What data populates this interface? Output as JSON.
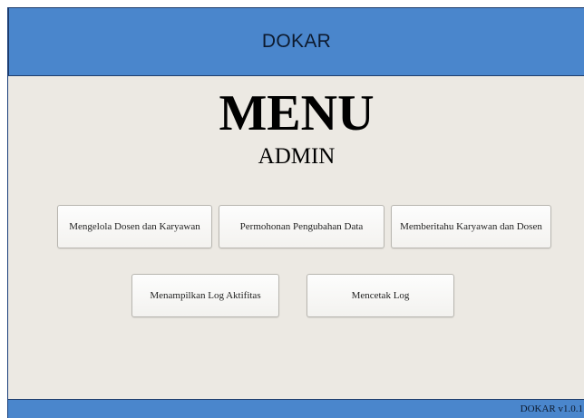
{
  "header": {
    "title": "DOKAR"
  },
  "menu": {
    "title": "MENU",
    "subtitle": "ADMIN"
  },
  "buttons": [
    {
      "label": "Mengelola Dosen dan Karyawan"
    },
    {
      "label": "Permohonan Pengubahan Data"
    },
    {
      "label": "Memberitahu Karyawan dan Dosen"
    },
    {
      "label": "Menampilkan Log Aktifitas"
    },
    {
      "label": "Mencetak Log"
    }
  ],
  "footer": {
    "version": "DOKAR v1.0.1"
  },
  "colors": {
    "header_bg": "#4a86cc",
    "body_bg": "#ece9e3",
    "button_bg": "#fdfdfd"
  }
}
